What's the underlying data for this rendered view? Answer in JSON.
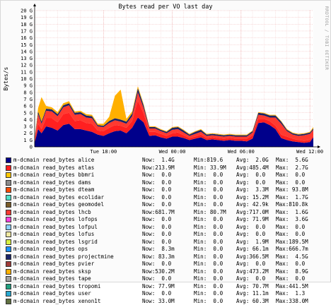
{
  "side_label": "RRDTOOL / TOBI OETIKER",
  "colors": {
    "alice": "#00008b",
    "atlas": "#ff2020",
    "bbmri": "#ffc800",
    "dams": "#8a8a8a",
    "dteam": "#ff4a00",
    "ecolidar": "#4fe0c8",
    "geomodel": "#7a5a28",
    "lhcb": "#ff3a30",
    "lofops": "#ff40e0",
    "lofpul": "#8ad0ff",
    "lofus": "#f0e8a0",
    "lsgrid": "#d8f040",
    "ops": "#1890ff",
    "projectmine": "#1a2468",
    "pvier": "#a03a38",
    "sksp": "#ffb000",
    "tape": "#a0a0a0",
    "tropomi": "#20a080",
    "user": "#28a8d0",
    "xenon1t": "#607040"
  },
  "chart_data": {
    "type": "area",
    "stacked": true,
    "title": "Bytes read per VO last day",
    "ylabel": "Bytes/s",
    "ylim": [
      0,
      20
    ],
    "y_unit": "G",
    "y_ticks": [
      "0",
      "1 G",
      "2 G",
      "3 G",
      "4 G",
      "5 G",
      "6 G",
      "7 G",
      "8 G",
      "9 G",
      "10 G",
      "11 G",
      "12 G",
      "13 G",
      "14 G",
      "15 G",
      "16 G",
      "17 G",
      "18 G",
      "19 G",
      "20 G"
    ],
    "x_ticks": [
      "Tue 18:00",
      "Wed 00:00",
      "Wed 06:00",
      "Wed 12:00"
    ],
    "x_tick_hours": [
      6,
      12,
      18,
      24
    ],
    "xlim_hours": [
      0,
      24.3
    ],
    "grid": true,
    "x": [
      0,
      0.3,
      0.6,
      1.0,
      1.5,
      2.0,
      2.5,
      3.0,
      3.5,
      4.0,
      4.5,
      5.0,
      5.5,
      6.0,
      6.5,
      7.0,
      7.5,
      8.0,
      8.5,
      9.0,
      9.5,
      10.0,
      10.5,
      11.0,
      11.5,
      12.0,
      12.5,
      13.0,
      13.5,
      14.0,
      14.5,
      15.0,
      15.5,
      16.0,
      16.5,
      17.0,
      17.5,
      18.0,
      18.5,
      19.0,
      19.5,
      20.0,
      20.5,
      21.0,
      21.5,
      22.0,
      22.5,
      23.0,
      23.5,
      24.0,
      24.3
    ],
    "series": [
      {
        "name": "m-dcmain read_bytes alice",
        "key": "alice",
        "values": [
          0.6,
          2.6,
          2.0,
          3.0,
          2.8,
          2.4,
          3.2,
          3.4,
          2.6,
          2.6,
          2.4,
          2.2,
          1.8,
          1.6,
          2.0,
          2.3,
          2.4,
          2.0,
          2.8,
          4.3,
          3.6,
          1.6,
          1.7,
          1.4,
          1.2,
          1.5,
          1.5,
          1.3,
          1.0,
          1.2,
          1.4,
          1.0,
          1.1,
          1.0,
          0.9,
          1.0,
          0.9,
          0.9,
          0.8,
          1.2,
          3.5,
          3.6,
          3.2,
          2.6,
          1.3,
          1.0,
          0.8,
          0.7,
          0.6,
          0.7,
          1.4
        ]
      },
      {
        "name": "m-dcmain read_bytes atlas",
        "key": "atlas",
        "values": [
          0.2,
          0.8,
          0.6,
          1.2,
          1.4,
          1.2,
          1.6,
          1.6,
          1.2,
          1.3,
          1.1,
          1.2,
          0.6,
          0.7,
          0.8,
          0.9,
          0.7,
          0.8,
          1.0,
          2.5,
          1.3,
          0.6,
          0.5,
          0.5,
          0.4,
          0.5,
          0.6,
          0.4,
          0.3,
          0.3,
          0.4,
          0.3,
          0.3,
          0.3,
          0.3,
          0.3,
          0.3,
          0.3,
          0.4,
          0.5,
          0.6,
          0.5,
          0.6,
          0.5,
          0.5,
          0.5,
          0.4,
          0.3,
          0.3,
          0.3,
          0.2
        ]
      },
      {
        "name": "m-dcmain read_bytes bbmri",
        "key": "bbmri",
        "values": []
      },
      {
        "name": "m-dcmain read_bytes dams",
        "key": "dams",
        "values": []
      },
      {
        "name": "m-dcmain read_bytes dteam",
        "key": "dteam",
        "values": []
      },
      {
        "name": "m-dcmain read_bytes ecolidar",
        "key": "ecolidar",
        "values": []
      },
      {
        "name": "m-dcmain read_bytes geomodel",
        "key": "geomodel",
        "values": []
      },
      {
        "name": "m-dcmain read_bytes lhcb",
        "key": "lhcb",
        "values": [
          0.3,
          1.4,
          0.8,
          1.1,
          1.0,
          0.9,
          1.0,
          1.1,
          0.9,
          0.9,
          0.8,
          0.8,
          0.6,
          0.6,
          0.7,
          0.7,
          0.6,
          0.6,
          0.7,
          1.2,
          0.8,
          0.5,
          0.5,
          0.4,
          0.4,
          0.5,
          0.5,
          0.4,
          0.3,
          0.4,
          0.4,
          0.3,
          0.3,
          0.3,
          0.3,
          0.3,
          0.3,
          0.3,
          0.3,
          0.4,
          0.6,
          0.5,
          0.5,
          1.2,
          1.6,
          0.8,
          0.6,
          0.6,
          0.8,
          0.9,
          0.9
        ]
      },
      {
        "name": "m-dcmain read_bytes lofops",
        "key": "lofops",
        "values": []
      },
      {
        "name": "m-dcmain read_bytes lofpul",
        "key": "lofpul",
        "values": []
      },
      {
        "name": "m-dcmain read_bytes lofus",
        "key": "lofus",
        "values": []
      },
      {
        "name": "m-dcmain read_bytes lsgrid",
        "key": "lsgrid",
        "values": []
      },
      {
        "name": "m-dcmain read_bytes ops",
        "key": "ops",
        "values": []
      },
      {
        "name": "m-dcmain read_bytes projectmine",
        "key": "projectmine",
        "values": [
          0.1,
          0.4,
          0.3,
          0.3,
          0.3,
          0.3,
          0.3,
          0.3,
          0.3,
          0.3,
          0.3,
          0.3,
          0.2,
          0.2,
          0.3,
          0.3,
          0.3,
          0.3,
          0.4,
          0.6,
          0.4,
          0.2,
          0.2,
          0.2,
          0.2,
          0.3,
          0.3,
          0.3,
          0.2,
          0.3,
          0.3,
          0.2,
          0.2,
          0.2,
          0.2,
          0.2,
          0.2,
          0.2,
          0.2,
          0.2,
          0.3,
          0.3,
          0.3,
          0.3,
          0.3,
          0.2,
          0.2,
          0.2,
          0.2,
          0.2,
          0.2
        ]
      },
      {
        "name": "m-dcmain read_bytes pvier",
        "key": "pvier",
        "values": []
      },
      {
        "name": "m-dcmain read_bytes sksp",
        "key": "sksp",
        "values": [
          0,
          0.5,
          3.6,
          0.4,
          0.3,
          0.3,
          0.3,
          0.3,
          0.2,
          0.2,
          0.2,
          0.2,
          0.2,
          0.3,
          0.6,
          3.3,
          4.4,
          0.4,
          0.3,
          0.3,
          0.2,
          0.1,
          0.1,
          0.1,
          0.1,
          0.1,
          0.1,
          0.1,
          0.1,
          0.1,
          0.1,
          0.1,
          0.1,
          0.1,
          0.1,
          0.1,
          0.1,
          0.1,
          0.1,
          0.1,
          0.1,
          0.1,
          0.1,
          0.1,
          0.1,
          0.1,
          0.1,
          0.1,
          0.1,
          0.1,
          0.2
        ]
      },
      {
        "name": "m-dcmain read_bytes tape",
        "key": "tape",
        "values": []
      },
      {
        "name": "m-dcmain read_bytes tropomi",
        "key": "tropomi",
        "values": []
      },
      {
        "name": "m-dcmain read_bytes user",
        "key": "user",
        "values": []
      },
      {
        "name": "m-dcmain read_bytes xenon1t",
        "key": "xenon1t",
        "values": []
      }
    ]
  },
  "legend": [
    {
      "key": "alice",
      "name": "m-dcmain read_bytes alice",
      "now": "Now:  1.4G",
      "min": "Min:819.6",
      "avg": "Avg:  2.0G",
      "max": "Max:  5.6G"
    },
    {
      "key": "atlas",
      "name": "m-dcmain read_bytes atlas",
      "now": "Now:213.9M",
      "min": "Min: 33.9M",
      "avg": "Avg:485.4M",
      "max": "Max:  2.7G"
    },
    {
      "key": "bbmri",
      "name": "m-dcmain read_bytes bbmri",
      "now": "Now:  0.0",
      "min": "Min:  0.0",
      "avg": "Avg:  0.0",
      "max": "Max:  0.0"
    },
    {
      "key": "dams",
      "name": "m-dcmain read_bytes dams",
      "now": "Now:  0.0",
      "min": "Min:  0.0",
      "avg": "Avg:  0.0",
      "max": "Max:  0.0"
    },
    {
      "key": "dteam",
      "name": "m-dcmain read_bytes dteam",
      "now": "Now:  0.0",
      "min": "Min:  0.0",
      "avg": "Avg:  3.3M",
      "max": "Max: 93.8M"
    },
    {
      "key": "ecolidar",
      "name": "m-dcmain read_bytes ecolidar",
      "now": "Now:  0.0",
      "min": "Min:  0.0",
      "avg": "Avg: 15.2M",
      "max": "Max:  1.7G"
    },
    {
      "key": "geomodel",
      "name": "m-dcmain read_bytes geomodel",
      "now": "Now:  0.0",
      "min": "Min:  0.0",
      "avg": "Avg: 42.9k",
      "max": "Max:810.8k"
    },
    {
      "key": "lhcb",
      "name": "m-dcmain read_bytes lhcb",
      "now": "Now:681.7M",
      "min": "Min: 80.7M",
      "avg": "Avg:717.0M",
      "max": "Max:  1.6G"
    },
    {
      "key": "lofops",
      "name": "m-dcmain read_bytes lofops",
      "now": "Now:  0.0",
      "min": "Min:  0.0",
      "avg": "Avg: 71.9M",
      "max": "Max:  3.6G"
    },
    {
      "key": "lofpul",
      "name": "m-dcmain read_bytes lofpul",
      "now": "Now:  0.0",
      "min": "Min:  0.0",
      "avg": "Avg:  0.0",
      "max": "Max:  0.0"
    },
    {
      "key": "lofus",
      "name": "m-dcmain read_bytes lofus",
      "now": "Now:  0.0",
      "min": "Min:  0.0",
      "avg": "Avg:  0.0",
      "max": "Max:  0.0"
    },
    {
      "key": "lsgrid",
      "name": "m-dcmain read_bytes lsgrid",
      "now": "Now:  0.0",
      "min": "Min:  0.0",
      "avg": "Avg:  1.9M",
      "max": "Max:189.5M"
    },
    {
      "key": "ops",
      "name": "m-dcmain read_bytes ops",
      "now": "Now:  8.3m",
      "min": "Min:  0.0",
      "avg": "Avg: 66.1m",
      "max": "Max:666.7m"
    },
    {
      "key": "projectmine",
      "name": "m-dcmain read_bytes projectmine",
      "now": "Now: 83.3m",
      "min": "Min:  0.0",
      "avg": "Avg:366.5M",
      "max": "Max:  4.5G"
    },
    {
      "key": "pvier",
      "name": "m-dcmain read_bytes pvier",
      "now": "Now:  0.0",
      "min": "Min:  0.0",
      "avg": "Avg:  0.0",
      "max": "Max:  0.0"
    },
    {
      "key": "sksp",
      "name": "m-dcmain read_bytes sksp",
      "now": "Now:530.2M",
      "min": "Min:  0.0",
      "avg": "Avg:473.2M",
      "max": "Max:  8.9G"
    },
    {
      "key": "tape",
      "name": "m-dcmain read_bytes tape",
      "now": "Now:  0.0",
      "min": "Min:  0.0",
      "avg": "Avg:  0.0",
      "max": "Max:  0.0"
    },
    {
      "key": "tropomi",
      "name": "m-dcmain read_bytes tropomi",
      "now": "Now: 77.9M",
      "min": "Min:  0.0",
      "avg": "Avg: 70.7M",
      "max": "Max:441.5M"
    },
    {
      "key": "user",
      "name": "m-dcmain read_bytes user",
      "now": "Now:  0.0",
      "min": "Min:  0.0",
      "avg": "Avg: 11.1m",
      "max": "Max:  1.3"
    },
    {
      "key": "xenon1t",
      "name": "m-dcmain read_bytes xenon1t",
      "now": "Now: 33.0M",
      "min": "Min:  0.0",
      "avg": "Avg: 60.3M",
      "max": "Max:338.0M"
    }
  ]
}
